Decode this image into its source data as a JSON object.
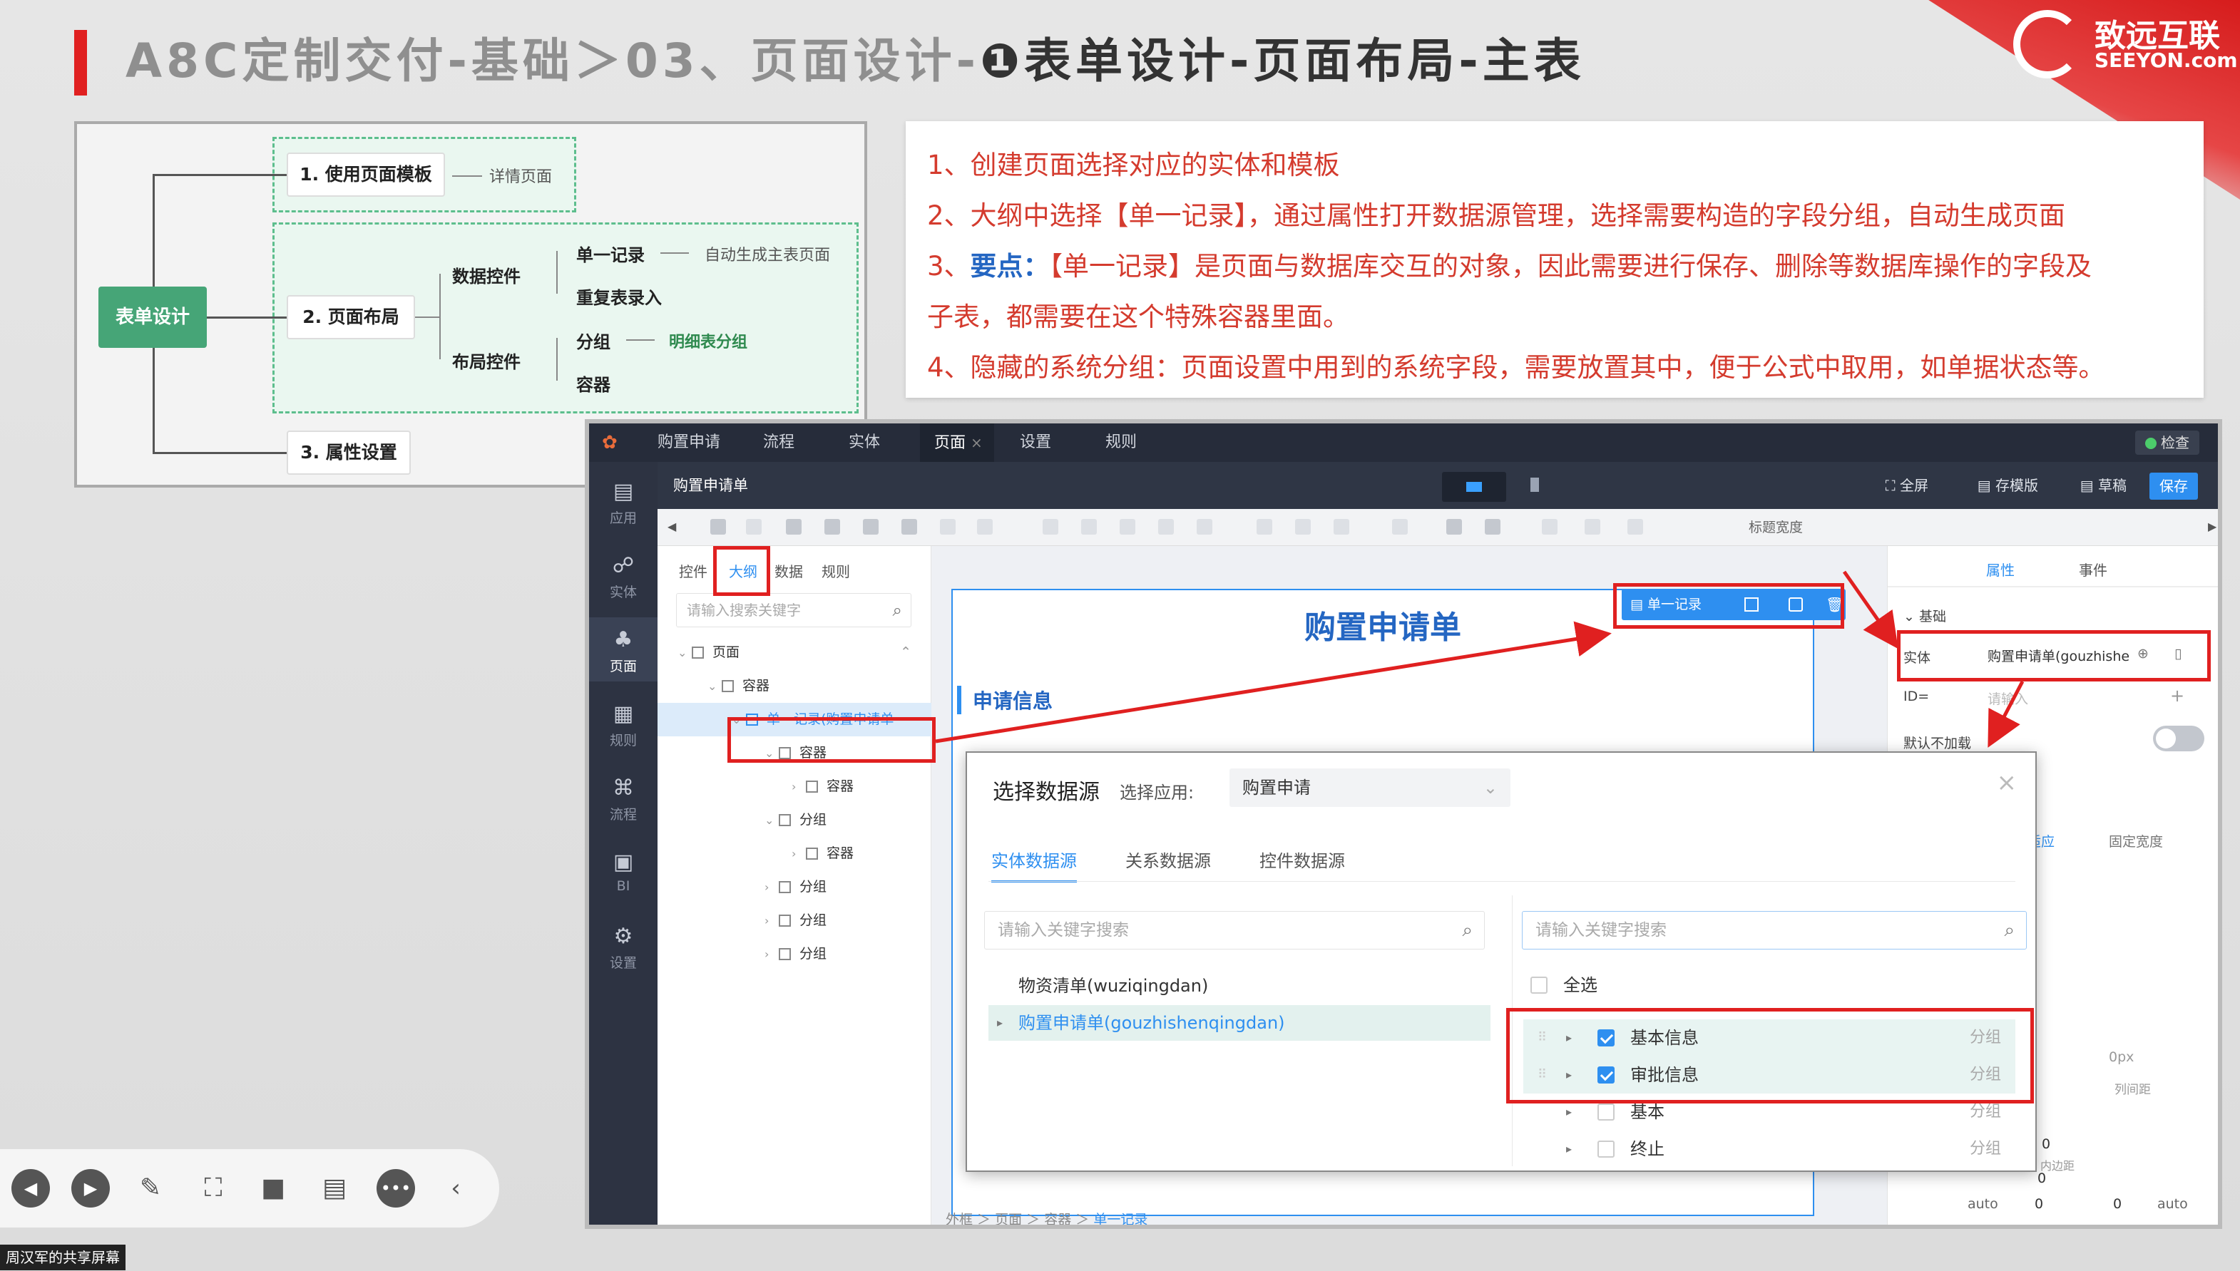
{
  "slide": {
    "title_prefix": "A8C定制交付-基础＞03、页面设计-",
    "title_main": "❶表单设计-页面布局-主表",
    "logo_cn": "致远互联",
    "logo_en": "SEEYON.com"
  },
  "mindmap": {
    "root": "表单设计",
    "n1": "1. 使用页面模板",
    "n1_note": "详情页面",
    "n2": "2. 页面布局",
    "n3": "3. 属性设置",
    "data_ctrl": "数据控件",
    "single_record": "单一记录",
    "single_note": "自动生成主表页面",
    "repeat_table": "重复表录入",
    "layout_ctrl": "布局控件",
    "group": "分组",
    "group_note": "明细表分组",
    "container": "容器"
  },
  "instructions": {
    "l1": "1、创建页面选择对应的实体和模板",
    "l2": "2、大纲中选择【单一记录】，通过属性打开数据源管理，选择需要构造的字段分组，自动生成页面",
    "l3_num": "3、",
    "l3_key": "要点：",
    "l3_rest": "【单一记录】是页面与数据库交互的对象，因此需要进行保存、删除等数据库操作的字段及",
    "l3b": "子表，都需要在这个特殊容器里面。",
    "l4": "4、隐藏的系统分组：页面设置中用到的系统字段，需要放置其中，便于公式中取用，如单据状态等。"
  },
  "app": {
    "tabs": [
      "购置申请",
      "流程",
      "实体",
      "页面",
      "设置",
      "规则"
    ],
    "tab_close": "×",
    "check": "检查",
    "side": [
      "应用",
      "实体",
      "页面",
      "规则",
      "流程",
      "BI",
      "设置"
    ],
    "page_title": "购置申请单",
    "fullscreen": "全屏",
    "save_template": "存模版",
    "draft": "草稿",
    "save": "保存",
    "title_width": "标题宽度",
    "left_tabs": [
      "控件",
      "大纲",
      "数据",
      "规则"
    ],
    "search_placeholder": "请输入搜索关键字",
    "tree": [
      "页面",
      "容器",
      "单一记录(购置申请单",
      "容器",
      "容器",
      "分组",
      "容器",
      "分组",
      "分组",
      "分组"
    ],
    "form_title": "购置申请单",
    "section": "申请信息",
    "record_btn": "单一记录",
    "breadcrumb": [
      "外框",
      "页面",
      "容器",
      "单一记录"
    ],
    "right_tabs": [
      "属性",
      "事件"
    ],
    "basic": "基础",
    "entity_label": "实体",
    "entity_value": "购置申请单(gouzhishe",
    "id_label": "ID=",
    "id_placeholder": "请输入",
    "default_load": "默认不加载",
    "adapt": "适应",
    "fixed_width": "固定宽度",
    "px0": "0px",
    "col_gap": "列间距",
    "inner_margin": "内边距",
    "zero": "0",
    "auto": "auto"
  },
  "modal": {
    "title": "选择数据源",
    "app_label": "选择应用:",
    "app_value": "购置申请",
    "tabs": [
      "实体数据源",
      "关系数据源",
      "控件数据源"
    ],
    "search_placeholder": "请输入关键字搜索",
    "sources": [
      "物资清单(wuziqingdan)",
      "购置申请单(gouzhishenqingdan)"
    ],
    "select_all": "全选",
    "fields": [
      {
        "name": "基本信息",
        "type": "分组",
        "checked": true
      },
      {
        "name": "审批信息",
        "type": "分组",
        "checked": true
      },
      {
        "name": "基本",
        "type": "分组",
        "checked": false
      },
      {
        "name": "终止",
        "type": "分组",
        "checked": false
      }
    ]
  },
  "share_label": "周汉军的共享屏幕"
}
